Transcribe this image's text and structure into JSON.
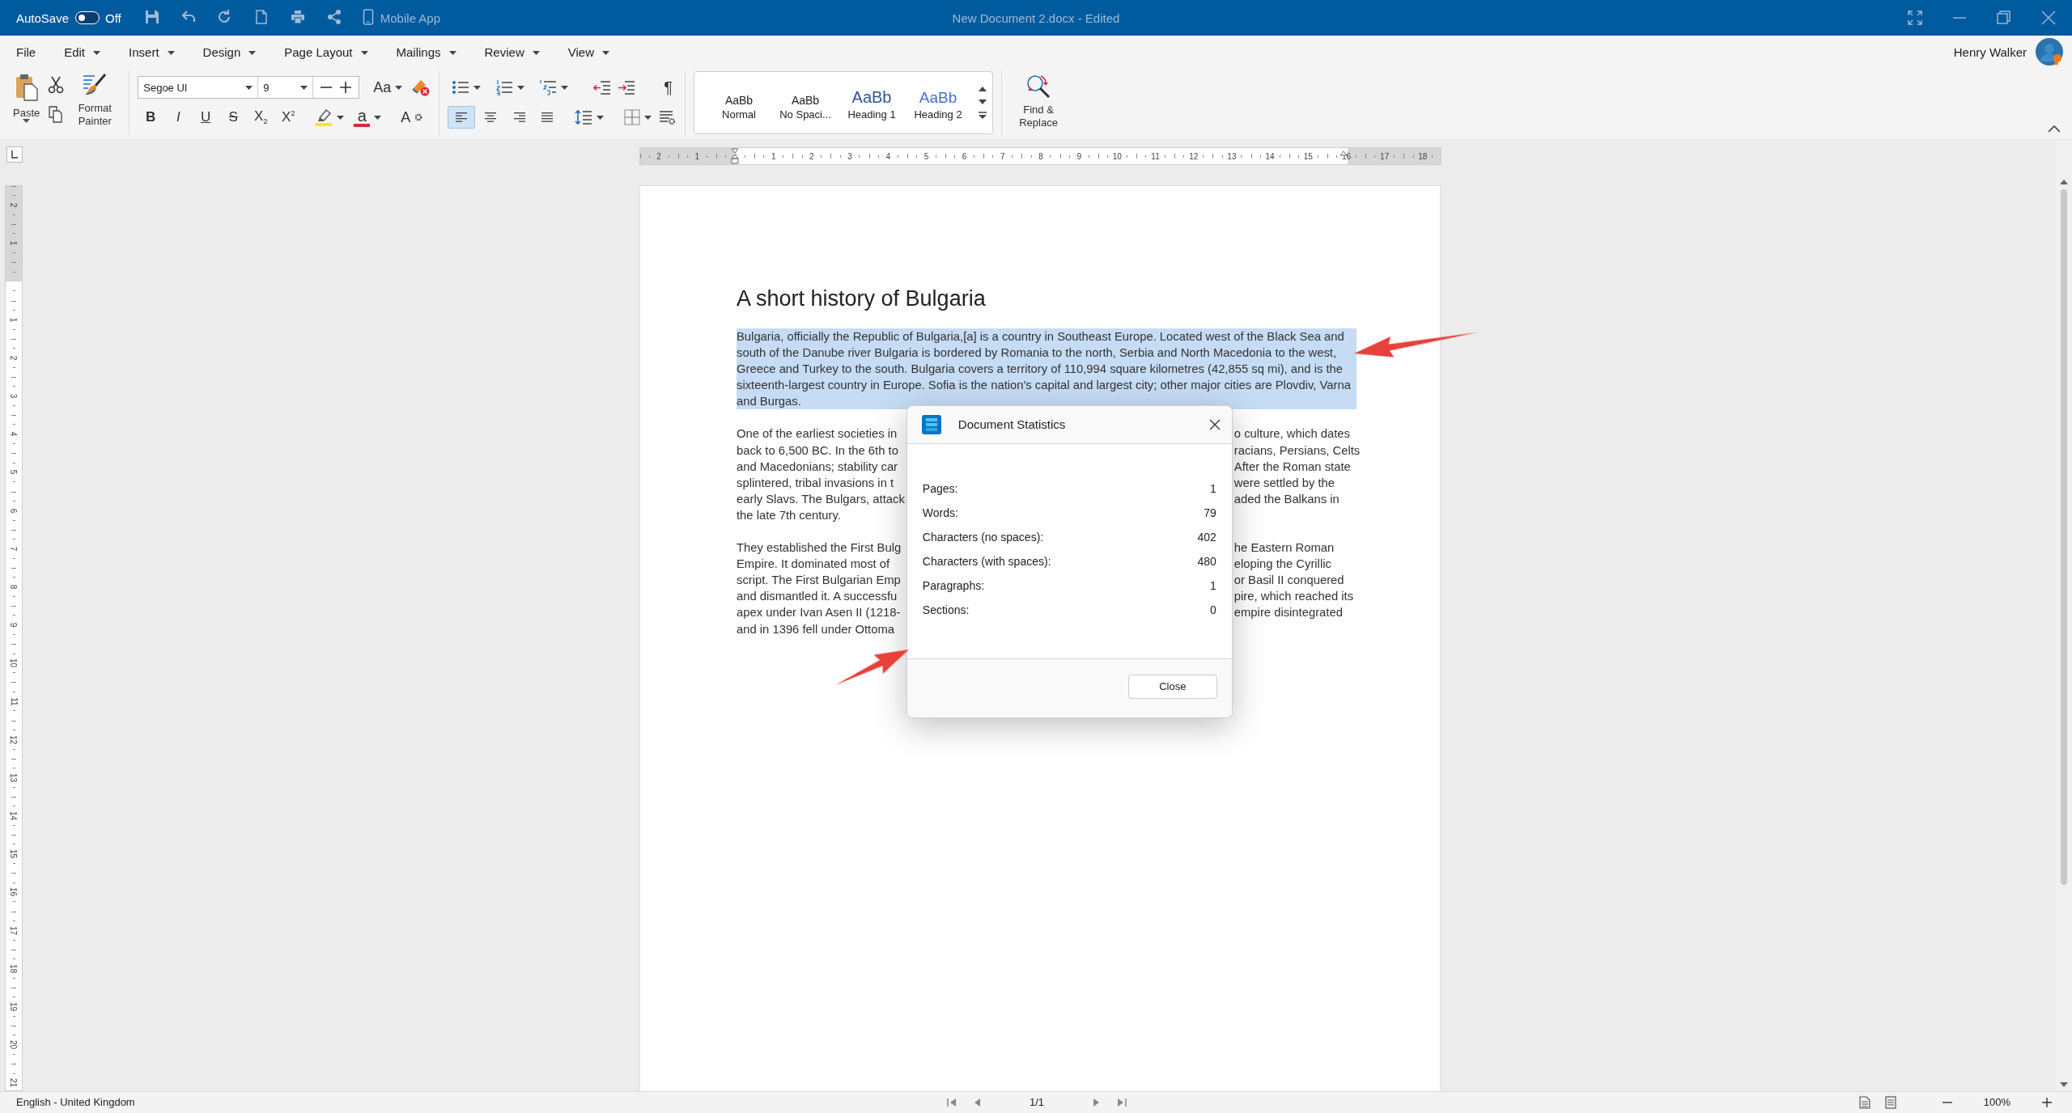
{
  "window": {
    "title": "New Document 2.docx - Edited"
  },
  "quick_access": {
    "autosave": {
      "label": "AutoSave",
      "on": false,
      "state_label": "Off"
    },
    "mobile_app": "Mobile App"
  },
  "menu": [
    {
      "label": "File",
      "dropdown": false
    },
    {
      "label": "Edit",
      "dropdown": true
    },
    {
      "label": "Insert",
      "dropdown": true
    },
    {
      "label": "Design",
      "dropdown": true
    },
    {
      "label": "Page Layout",
      "dropdown": true
    },
    {
      "label": "Mailings",
      "dropdown": true
    },
    {
      "label": "Review",
      "dropdown": true
    },
    {
      "label": "View",
      "dropdown": true
    }
  ],
  "user": {
    "name": "Henry Walker"
  },
  "ribbon": {
    "clipboard": {
      "paste": "Paste",
      "format_painter": "Format Painter"
    },
    "font": {
      "family": "Segoe UI",
      "size": "9",
      "case_button": "Aa",
      "font_color": "a",
      "char_style": "A",
      "formats": [
        {
          "label": "B",
          "kind": "bold"
        },
        {
          "label": "I",
          "kind": "italic"
        },
        {
          "label": "U",
          "kind": "underline"
        },
        {
          "label": "S",
          "kind": "strike"
        },
        {
          "label": "X$_{2}$",
          "kind": "subscript"
        },
        {
          "label": "X$^{2}$",
          "kind": "superscript"
        }
      ]
    },
    "paragraph": {
      "pilcrow": "¶",
      "alignment": [
        {
          "kind": "left",
          "selected": true
        },
        {
          "kind": "center",
          "selected": false
        },
        {
          "kind": "right",
          "selected": false
        },
        {
          "kind": "justify",
          "selected": false
        }
      ]
    },
    "styles": [
      {
        "sample": "AaBb",
        "label": "Normal",
        "kind": "normal"
      },
      {
        "sample": "AaBb",
        "label": "No Spaci...",
        "kind": "normal"
      },
      {
        "sample": "AaBb",
        "label": "Heading 1",
        "kind": "heading1"
      },
      {
        "sample": "AaBb",
        "label": "Heading 2",
        "kind": "heading2"
      }
    ],
    "find_replace": "Find & Replace"
  },
  "ruler": {
    "horizontal": {
      "before": [
        "2",
        "1"
      ],
      "after": [
        "1",
        "2",
        "3",
        "4",
        "5",
        "6",
        "7",
        "8",
        "9",
        "10",
        "11",
        "12",
        "13",
        "14",
        "15",
        "16",
        "17",
        "18"
      ]
    },
    "vertical": {
      "before": [
        "2",
        "1"
      ],
      "after": [
        "1",
        "2",
        "3",
        "4",
        "5",
        "6",
        "7",
        "8",
        "9",
        "10",
        "11",
        "12",
        "13",
        "14",
        "15",
        "16",
        "17",
        "18",
        "19",
        "20",
        "21"
      ]
    }
  },
  "document": {
    "title": "A short history of Bulgaria",
    "paragraphs": [
      {
        "kind": "full",
        "selected": true,
        "text": "Bulgaria, officially the Republic of Bulgaria,[a] is a country in Southeast Europe. Located west of the Black Sea and south of the Danube river Bulgaria is bordered by Romania to the north, Serbia and North Macedonia to the west, Greece and Turkey to the south. Bulgaria covers a territory of 110,994 square kilometres (42,855 sq mi), and is the sixteenth-largest country in Europe. Sofia is the nation's capital and largest city; other major cities are Plovdiv, Varna and Burgas."
      },
      {
        "kind": "covered",
        "lines": [
          {
            "left": "One of the earliest societies in",
            "right": "o culture, which dates"
          },
          {
            "left": "back to 6,500 BC. In the 6th to",
            "right": "racians, Persians, Celts"
          },
          {
            "left": "and Macedonians; stability car",
            "right": "After the Roman state"
          },
          {
            "left": "splintered, tribal invasions in t",
            "right": "were settled by the"
          },
          {
            "left": "early Slavs. The Bulgars, attack",
            "right": "aded the Balkans in"
          },
          {
            "left": "the late 7th century."
          }
        ]
      },
      {
        "kind": "covered",
        "lines": [
          {
            "left": "They established the First Bulg",
            "right": "he Eastern Roman"
          },
          {
            "left": "Empire. It dominated most of",
            "right": "eloping the Cyrillic"
          },
          {
            "left": "script. The First Bulgarian Emp",
            "right": "or Basil II conquered"
          },
          {
            "left": "and dismantled it. A successfu",
            "right": "pire, which reached its"
          },
          {
            "left": "apex under Ivan Asen II (1218-",
            "right": "empire disintegrated"
          },
          {
            "left": "and in 1396 fell under Ottoma"
          }
        ]
      }
    ]
  },
  "dialog": {
    "title": "Document Statistics",
    "stats": [
      {
        "label": "Pages:",
        "value": "1"
      },
      {
        "label": "Words:",
        "value": "79"
      },
      {
        "label": "Characters (no spaces):",
        "value": "402"
      },
      {
        "label": "Characters (with spaces):",
        "value": "480"
      },
      {
        "label": "Paragraphs:",
        "value": "1"
      },
      {
        "label": "Sections:",
        "value": "0"
      }
    ],
    "close": "Close"
  },
  "status_bar": {
    "language": "English - United Kingdom",
    "page": "1/1",
    "zoom": "100%"
  }
}
